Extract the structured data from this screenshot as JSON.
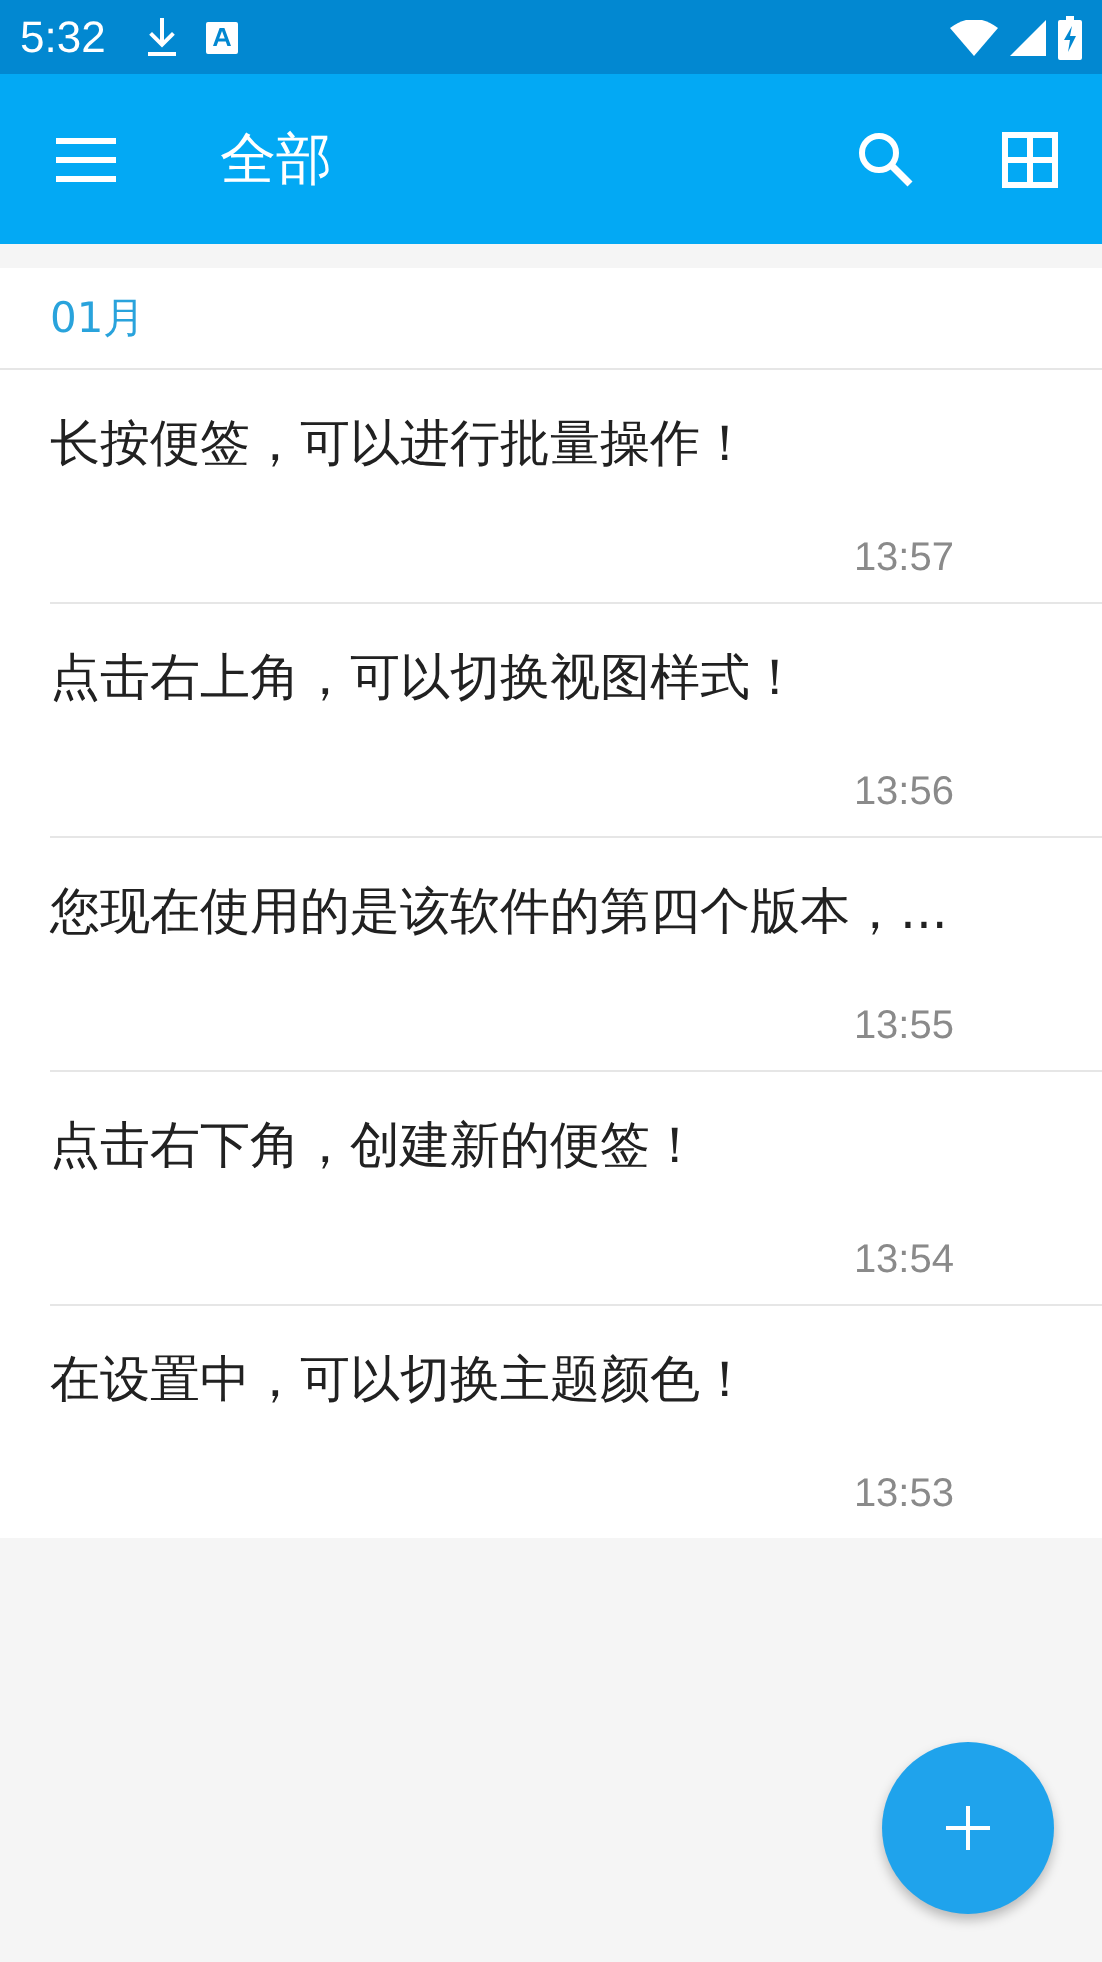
{
  "status_bar": {
    "time": "5:32"
  },
  "app_bar": {
    "title": "全部"
  },
  "section": {
    "title": "01月"
  },
  "notes": [
    {
      "text": "长按便签，可以进行批量操作！",
      "time": "13:57"
    },
    {
      "text": "点击右上角，可以切换视图样式！",
      "time": "13:56"
    },
    {
      "text": "您现在使用的是该软件的第四个版本，...",
      "time": "13:55"
    },
    {
      "text": "点击右下角，创建新的便签！",
      "time": "13:54"
    },
    {
      "text": "在设置中，可以切换主题颜色！",
      "time": "13:53"
    }
  ]
}
